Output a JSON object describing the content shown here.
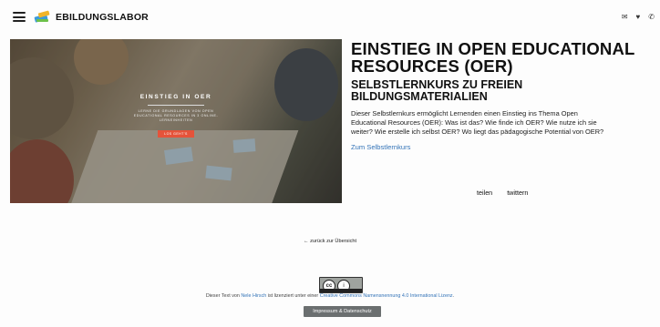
{
  "header": {
    "brand": "EBILDUNGSLABOR",
    "icons": [
      "menu-icon",
      "logo-icon",
      "mail-icon",
      "twitter-icon",
      "phone-icon"
    ],
    "icon_glyphs": {
      "mail": "✉",
      "twitter": "♥",
      "phone": "✆"
    }
  },
  "hero": {
    "overlay_title": "EINSTIEG IN OER",
    "overlay_text": "LERNE DIE GRUNDLAGEN VON OPEN EDUCATIONAL RESOURCES IN 3 ONLINE-LERNEINHEITEN",
    "overlay_button": "LOS GEHT'S"
  },
  "main": {
    "title": "EINSTIEG IN OPEN EDUCATIONAL RESOURCES (OER)",
    "subtitle": "SELBSTLERNKURS ZU FREIEN BILDUNGSMATERIALIEN",
    "description_line1": "Dieser Selbstlernkurs ermöglicht Lernenden einen Einstieg ins Thema Open",
    "description_line2": "Educational Resources (OER): Was ist das? Wie finde ich OER? Wie nutze ich sie",
    "description_line3": "weiter? Wie erstelle ich selbst OER? Wo liegt das pädagogische Potential von OER?",
    "course_link": "Zum Selbstlernkurs",
    "share": "teilen",
    "twitter": "twittern"
  },
  "back_link": "← zurück zur Übersicht",
  "license": {
    "prefix": "Dieser Text von ",
    "author": "Nele Hirsch",
    "middle": " ist lizenziert unter einer ",
    "license_name": "Creative Commons Namensnennung 4.0 International Lizenz",
    "suffix": "."
  },
  "footer": {
    "impressum": "Impressum & Datenschutz"
  },
  "colors": {
    "link": "#3474b8",
    "hero_button": "#e5533a",
    "impressum_bg": "#6b6f70"
  }
}
